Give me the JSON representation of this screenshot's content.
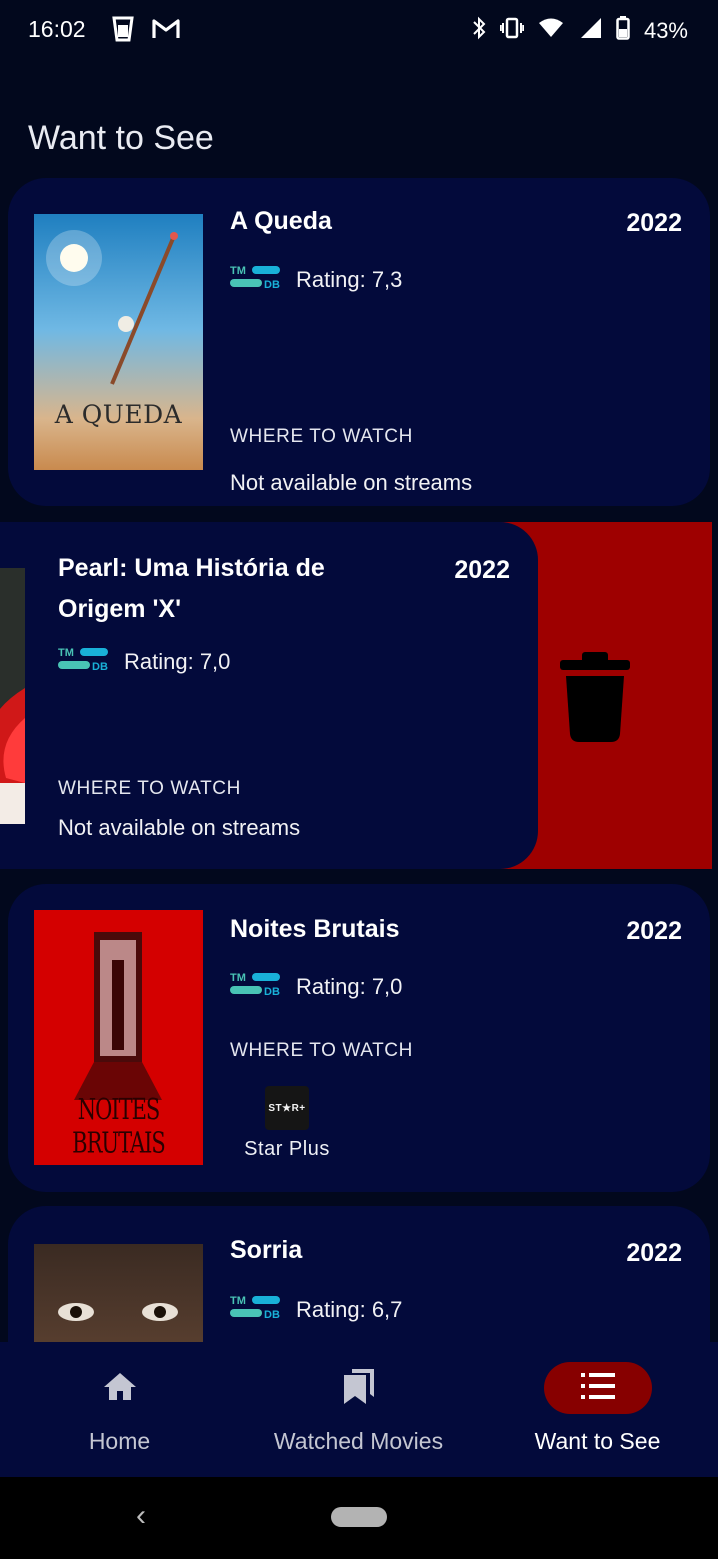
{
  "status_bar": {
    "time": "16:02",
    "left_icons": [
      "beer-glass-icon",
      "gmail-icon"
    ],
    "right_icons": [
      "bluetooth-icon",
      "vibrate-icon",
      "wifi-icon",
      "signal-icon",
      "battery-icon"
    ],
    "battery": "43%"
  },
  "page": {
    "title": "Want to See"
  },
  "movies": [
    {
      "title": "A Queda",
      "year": "2022",
      "rating_label": "Rating: 7,3",
      "where_label": "WHERE TO WATCH",
      "availability": "Not available on streams",
      "poster_text": "A QUEDA"
    },
    {
      "title": "Pearl: Uma História de Origem 'X'",
      "year": "2022",
      "rating_label": "Rating: 7,0",
      "where_label": "WHERE TO WATCH",
      "availability": "Not available on streams"
    },
    {
      "title": "Noites Brutais",
      "year": "2022",
      "rating_label": "Rating: 7,0",
      "where_label": "WHERE TO WATCH",
      "provider": {
        "logo_text": "ST★R+",
        "name": "Star Plus"
      },
      "poster_text": "NOITES BRUTAIS"
    },
    {
      "title": "Sorria",
      "year": "2022",
      "rating_label": "Rating: 6,7"
    }
  ],
  "tmdb_logo": {
    "top": "TM",
    "bottom": "DB"
  },
  "colors": {
    "background": "#02081d",
    "card": "#030a3b",
    "delete": "#9e0000",
    "active_nav": "#870000",
    "tmdb_teal": "#49c3b5",
    "tmdb_blue": "#19b1d8"
  },
  "bottom_nav": {
    "items": [
      {
        "label": "Home",
        "icon": "home-icon"
      },
      {
        "label": "Watched Movies",
        "icon": "bookmarks-icon"
      },
      {
        "label": "Want to See",
        "icon": "list-icon",
        "active": true
      }
    ]
  }
}
